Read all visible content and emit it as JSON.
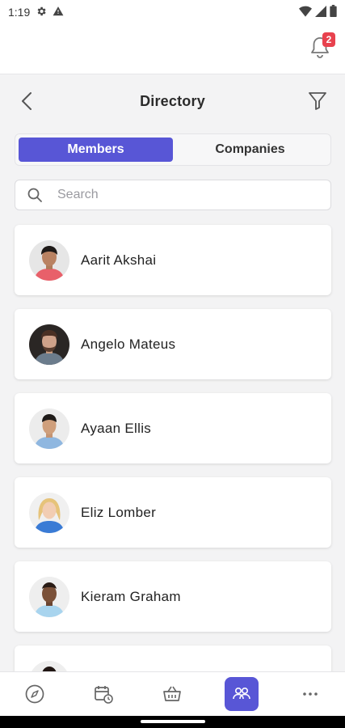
{
  "status_bar": {
    "time": "1:19"
  },
  "header": {
    "notification_count": "2"
  },
  "nav": {
    "title": "Directory"
  },
  "tabs": {
    "members": "Members",
    "companies": "Companies"
  },
  "search": {
    "placeholder": "Search",
    "value": ""
  },
  "members": [
    {
      "name": "Aarit Akshai"
    },
    {
      "name": "Angelo Mateus"
    },
    {
      "name": "Ayaan Ellis"
    },
    {
      "name": "Eliz Lomber"
    },
    {
      "name": "Kieram Graham"
    },
    {
      "name": ""
    }
  ],
  "colors": {
    "accent": "#5856d6",
    "badge": "#e8424e",
    "background": "#f3f3f4"
  },
  "bottom_nav": {
    "items": [
      {
        "icon": "compass-icon",
        "active": false
      },
      {
        "icon": "calendar-clock-icon",
        "active": false
      },
      {
        "icon": "basket-icon",
        "active": false
      },
      {
        "icon": "people-icon",
        "active": true
      },
      {
        "icon": "more-icon",
        "active": false
      }
    ]
  }
}
